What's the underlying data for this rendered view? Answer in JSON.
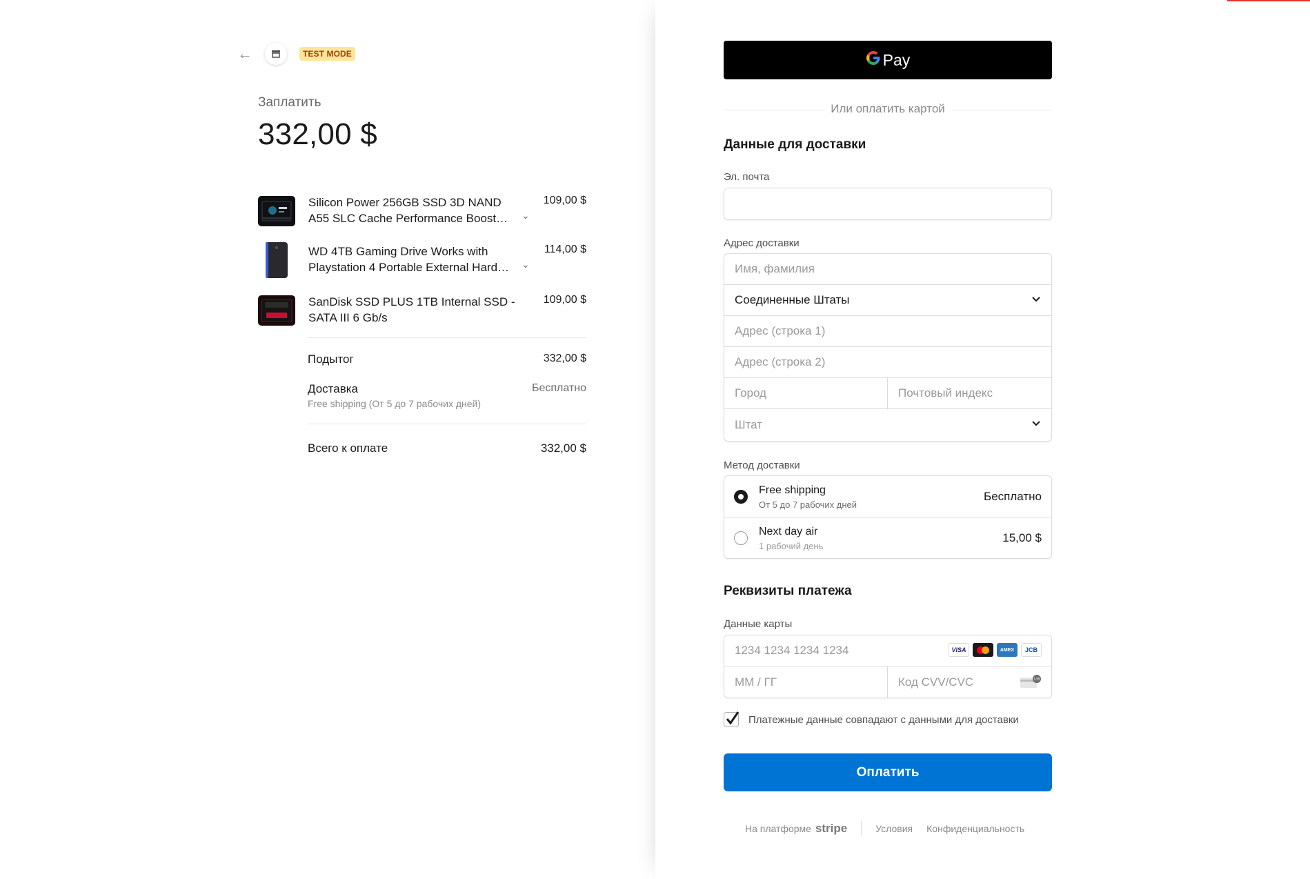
{
  "header": {
    "test_mode": "TEST MODE"
  },
  "summary": {
    "pay_label": "Заплатить",
    "amount": "332,00 $",
    "items": [
      {
        "name": "Silicon Power 256GB SSD 3D NAND A55 SLC Cache Performance Boost…",
        "price": "109,00 $"
      },
      {
        "name": "WD 4TB Gaming Drive Works with Playstation 4 Portable External Hard…",
        "price": "114,00 $"
      },
      {
        "name": "SanDisk SSD PLUS 1TB Internal SSD - SATA III 6 Gb/s",
        "price": "109,00 $"
      }
    ],
    "subtotal_label": "Подытог",
    "subtotal_value": "332,00 $",
    "shipping_label": "Доставка",
    "shipping_value": "Бесплатно",
    "shipping_sub": "Free shipping (От 5 до 7 рабочих дней)",
    "total_label": "Всего к оплате",
    "total_value": "332,00 $"
  },
  "checkout": {
    "gpay_label": "Pay",
    "or_card": "Или оплатить картой",
    "delivery_title": "Данные для доставки",
    "email_label": "Эл. почта",
    "email_value": "",
    "address_label": "Адрес доставки",
    "name_placeholder": "Имя, фамилия",
    "country_value": "Соединенные Штаты",
    "address1_placeholder": "Адрес (строка 1)",
    "address2_placeholder": "Адрес (строка 2)",
    "city_placeholder": "Город",
    "zip_placeholder": "Почтовый индекс",
    "state_placeholder": "Штат",
    "shipping_method_label": "Метод доставки",
    "shipping_options": [
      {
        "name": "Free shipping",
        "desc": "От 5 до 7 рабочих дней",
        "price": "Бесплатно",
        "selected": true
      },
      {
        "name": "Next day air",
        "desc": "1 рабочий день",
        "price": "15,00 $",
        "selected": false
      }
    ],
    "payment_title": "Реквизиты платежа",
    "card_label": "Данные карты",
    "card_number_placeholder": "1234 1234 1234 1234",
    "expiry_placeholder": "ММ / ГГ",
    "cvc_placeholder": "Код CVV/CVC",
    "card_brands": {
      "visa": "VISA",
      "amex": "AMEX",
      "jcb": "JCB"
    },
    "billing_same_label": "Платежные данные совпадают с данными для доставки",
    "billing_same_checked": true,
    "pay_button": "Оплатить"
  },
  "footer": {
    "powered_by": "На платформе",
    "stripe": "stripe",
    "terms": "Условия",
    "privacy": "Конфиденциальность"
  },
  "colors": {
    "accent": "#0074d4",
    "badge_bg": "#fde59a",
    "badge_text": "#a0410b"
  }
}
